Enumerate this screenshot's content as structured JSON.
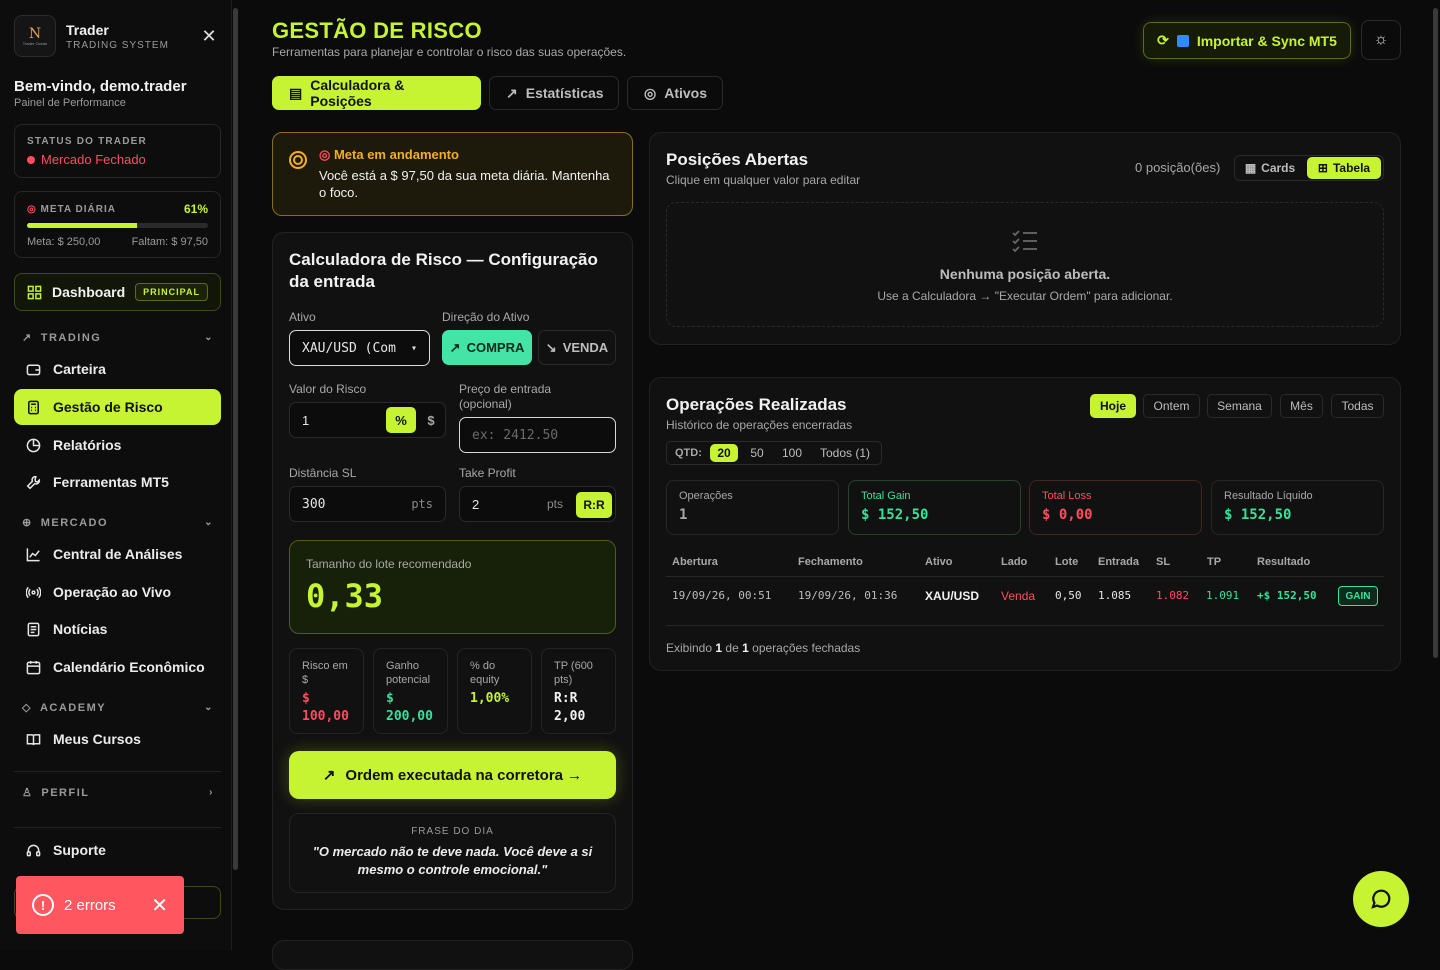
{
  "sidebar": {
    "brand_name": "Trader",
    "brand_sub": "TRADING SYSTEM",
    "logo_text": "Trader Ocean",
    "welcome": "Bem-vindo, demo.trader",
    "welcome_sub": "Painel de Performance",
    "status_label": "STATUS DO TRADER",
    "status_value": "Mercado Fechado",
    "meta_label": "META DIÁRIA",
    "meta_pct": "61%",
    "meta_progress": 0.61,
    "meta_target": "Meta: $ 250,00",
    "meta_missing": "Faltam: $ 97,50",
    "dashboard": "Dashboard",
    "dashboard_badge": "PRINCIPAL",
    "sections": {
      "trading": "TRADING",
      "mercado": "MERCADO",
      "academy": "ACADEMY",
      "perfil": "PERFIL"
    },
    "items": {
      "carteira": "Carteira",
      "gestao": "Gestão de Risco",
      "relatorios": "Relatórios",
      "ferramentas": "Ferramentas MT5",
      "analises": "Central de Análises",
      "aovivo": "Operação ao Vivo",
      "noticias": "Notícias",
      "calendario": "Calendário Econômico",
      "cursos": "Meus Cursos",
      "suporte": "Suporte"
    },
    "errors": "2 errors"
  },
  "header": {
    "title": "GESTÃO DE RISCO",
    "subtitle": "Ferramentas para planejar e controlar o risco das suas operações.",
    "import_btn": "Importar & Sync MT5"
  },
  "tabs": [
    "Calculadora & Posições",
    "Estatísticas",
    "Ativos"
  ],
  "goal": {
    "title": "Meta em andamento",
    "text": "Você está a $ 97,50 da sua meta diária. Mantenha o foco."
  },
  "calc": {
    "title": "Calculadora de Risco — Configuração da entrada",
    "ativo_label": "Ativo",
    "ativo_value": "XAU/USD (Com",
    "direcao_label": "Direção do Ativo",
    "compra": "COMPRA",
    "venda": "VENDA",
    "risco_label": "Valor do Risco",
    "risco_value": "1",
    "pct": "%",
    "dollar": "$",
    "entrada_label": "Preço de entrada (opcional)",
    "entrada_placeholder": "ex: 2412.50",
    "sl_label": "Distância SL",
    "sl_value": "300",
    "pts": "pts",
    "tp_label": "Take Profit",
    "tp_value": "2",
    "rr": "R:R",
    "lot_label": "Tamanho do lote recomendado",
    "lot_value": "0,33",
    "minis": [
      {
        "label": "Risco em $",
        "value": "$ 100,00"
      },
      {
        "label": "Ganho potencial",
        "value": "$ 200,00"
      },
      {
        "label": "% do equity",
        "value": "1,00%"
      },
      {
        "label": "TP (600 pts)",
        "value": "R:R 2,00"
      }
    ],
    "exec_btn": "Ordem executada na corretora →",
    "quote_label": "FRASE DO DIA",
    "quote": "\"O mercado não te deve nada. Você deve a si mesmo o controle emocional.\""
  },
  "positions": {
    "title": "Posições Abertas",
    "subtitle": "Clique em qualquer valor para editar",
    "count": "0 posição(ões)",
    "view_cards": "Cards",
    "view_table": "Tabela",
    "empty_title": "Nenhuma posição aberta.",
    "empty_sub": "Use a Calculadora → \"Executar Ordem\" para adicionar."
  },
  "ops": {
    "title": "Operações Realizadas",
    "subtitle": "Histórico de operações encerradas",
    "periods": [
      "Hoje",
      "Ontem",
      "Semana",
      "Mês",
      "Todas"
    ],
    "qtd_label": "QTD:",
    "qtd": [
      "20",
      "50",
      "100",
      "Todos (1)"
    ],
    "stats": [
      {
        "label": "Operações",
        "value": "1"
      },
      {
        "label": "Total Gain",
        "value": "$ 152,50"
      },
      {
        "label": "Total Loss",
        "value": "$ 0,00"
      },
      {
        "label": "Resultado Líquido",
        "value": "$ 152,50"
      }
    ],
    "columns": [
      "Abertura",
      "Fechamento",
      "Ativo",
      "Lado",
      "Lote",
      "Entrada",
      "SL",
      "TP",
      "Resultado"
    ],
    "row": {
      "abertura": "19/09/26, 00:51",
      "fechamento": "19/09/26, 01:36",
      "ativo": "XAU/USD",
      "lado": "Venda",
      "lote": "0,50",
      "entrada": "1.085",
      "sl": "1.082",
      "tp": "1.091",
      "resultado": "+$ 152,50",
      "tag": "GAIN"
    },
    "footer_a": "Exibindo",
    "footer_n1": "1",
    "footer_b": "de",
    "footer_n2": "1",
    "footer_c": "operações fechadas"
  },
  "colors": {
    "accent": "#c6f432",
    "loss": "#ff4d5e",
    "gain": "#33e39a",
    "warning": "#f0b020"
  }
}
